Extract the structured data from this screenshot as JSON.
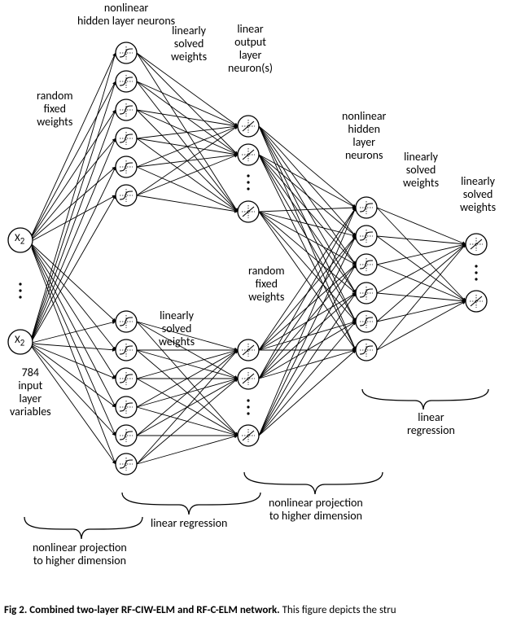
{
  "labels": {
    "nonlinear_hidden1": "nonlinear\nhidden layer neurons",
    "linearly_solved1": "linearly\nsolved\nweights",
    "linear_output1": "linear\noutput\nlayer\nneuron(s)",
    "random_fixed1": "random\nfixed\nweights",
    "nonlinear_hidden2": "nonlinear\nhidden\nlayer\nneurons",
    "linearly_solved2": "linearly\nsolved\nweights",
    "linearly_solved3": "linearly\nsolved\nweights",
    "random_fixed2": "random\nfixed\nweights",
    "linearly_solved4": "linearly\nsolved\nweights",
    "input_vars": "784\ninput\nlayer\nvariables",
    "lin_reg1": "linear\nregression",
    "lin_reg2": "linear\nregression",
    "nl_proj_lower": "nonlinear projection\nto higher dimension",
    "nl_proj_upper": "nonlinear projection\nto higher dimension",
    "lin_reg_bottom": "linear regression",
    "x2_label_a": "X",
    "x2_label_b": "X",
    "x2_sub": "2"
  },
  "caption": {
    "bold": "Fig 2. Combined two-layer RF-CIW-ELM and RF-C-ELM network.",
    "tail": " This figure depicts the stru"
  },
  "chart_data": {
    "type": "diagram",
    "title": "Combined two-layer RF-CIW-ELM and RF-C-ELM network",
    "layers": [
      {
        "name": "input",
        "count_label": "784 input layer variables",
        "nodes_drawn": 2,
        "node_text": "X₂"
      },
      {
        "name": "hidden1_upper",
        "description": "nonlinear hidden layer neurons (upper branch)",
        "nodes_drawn": 6
      },
      {
        "name": "hidden1_lower",
        "description": "nonlinear hidden layer neurons (lower branch)",
        "nodes_drawn": 6
      },
      {
        "name": "linear_out1_upper",
        "description": "linear output layer neuron(s) upper",
        "nodes_drawn": 3
      },
      {
        "name": "linear_out1_lower",
        "description": "linear output layer neuron(s) lower",
        "nodes_drawn": 3
      },
      {
        "name": "hidden2",
        "description": "nonlinear hidden layer neurons (second stage)",
        "nodes_drawn": 6
      },
      {
        "name": "output",
        "description": "linear output neurons",
        "nodes_drawn": 2
      }
    ],
    "connections": [
      {
        "from": "input",
        "to": "hidden1_upper",
        "label": "random fixed weights",
        "region_label": "nonlinear projection to higher dimension"
      },
      {
        "from": "input",
        "to": "hidden1_lower",
        "label": "random fixed weights",
        "region_label": "nonlinear projection to higher dimension"
      },
      {
        "from": "hidden1_upper",
        "to": "linear_out1_upper",
        "label": "linearly solved weights",
        "region_label": "linear regression"
      },
      {
        "from": "hidden1_lower",
        "to": "linear_out1_lower",
        "label": "linearly solved weights",
        "region_label": "linear regression"
      },
      {
        "from": "linear_out1_upper",
        "to": "hidden2",
        "label": "random fixed weights",
        "region_label": "nonlinear projection to higher dimension"
      },
      {
        "from": "linear_out1_lower",
        "to": "hidden2",
        "label": "random fixed weights"
      },
      {
        "from": "hidden2",
        "to": "output",
        "label": "linearly solved weights",
        "region_label": "linear regression"
      }
    ]
  }
}
